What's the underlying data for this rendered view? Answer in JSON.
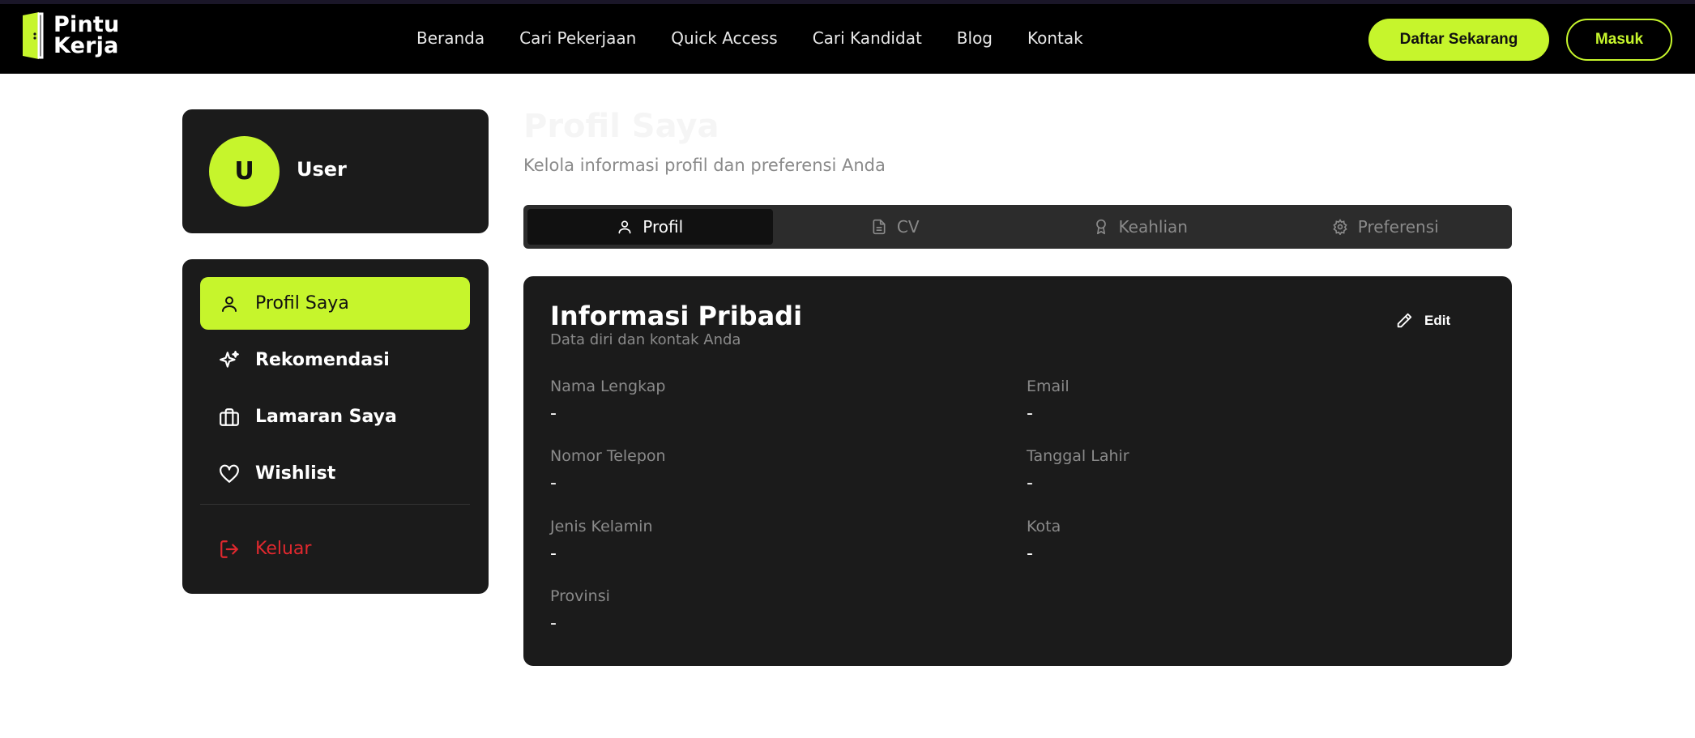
{
  "brand": {
    "line1": "Pintu",
    "line2": "Kerja",
    "accent": "#c6f52c"
  },
  "nav": {
    "links": [
      "Beranda",
      "Cari Pekerjaan",
      "Quick Access",
      "Cari Kandidat",
      "Blog",
      "Kontak"
    ],
    "signup_label": "Daftar Sekarang",
    "login_label": "Masuk"
  },
  "user": {
    "initial": "U",
    "name": "User"
  },
  "sidebar": {
    "items": [
      {
        "label": "Profil Saya",
        "icon": "user-icon"
      },
      {
        "label": "Rekomendasi",
        "icon": "sparkles-icon"
      },
      {
        "label": "Lamaran Saya",
        "icon": "briefcase-icon"
      },
      {
        "label": "Wishlist",
        "icon": "heart-icon"
      }
    ],
    "logout_label": "Keluar",
    "logout_color": "#e0282e"
  },
  "page": {
    "title": "Profil Saya",
    "subtitle": "Kelola informasi profil dan preferensi Anda"
  },
  "tabs": [
    {
      "label": "Profil",
      "icon": "user-icon"
    },
    {
      "label": "CV",
      "icon": "file-icon"
    },
    {
      "label": "Keahlian",
      "icon": "award-icon"
    },
    {
      "label": "Preferensi",
      "icon": "gear-icon"
    }
  ],
  "info": {
    "title": "Informasi Pribadi",
    "subtitle": "Data diri dan kontak Anda",
    "edit_label": "Edit",
    "fields": [
      {
        "label": "Nama Lengkap",
        "value": "-"
      },
      {
        "label": "Email",
        "value": "-"
      },
      {
        "label": "Nomor Telepon",
        "value": "-"
      },
      {
        "label": "Tanggal Lahir",
        "value": "-"
      },
      {
        "label": "Jenis Kelamin",
        "value": "-"
      },
      {
        "label": "Kota",
        "value": "-"
      },
      {
        "label": "Provinsi",
        "value": "-"
      }
    ]
  }
}
